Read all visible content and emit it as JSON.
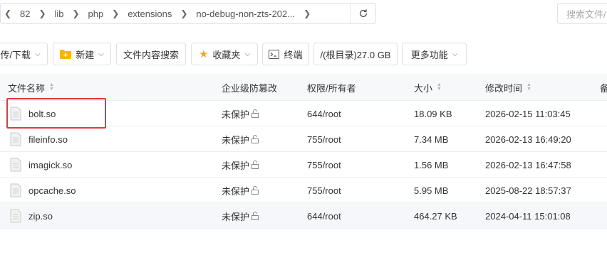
{
  "breadcrumb": {
    "segments": [
      "82",
      "lib",
      "php",
      "extensions",
      "no-debug-non-zts-202..."
    ]
  },
  "search": {
    "placeholder": "搜索文件/目录"
  },
  "toolbar": {
    "upload_label": "传/下载",
    "new_label": "新建",
    "content_search_label": "文件内容搜索",
    "favorites_label": "收藏夹",
    "terminal_label": "终端",
    "disk_label": "/(根目录)27.0 GB",
    "more_label": "更多功能"
  },
  "table": {
    "headers": {
      "name": "文件名称",
      "protection": "企业级防篡改",
      "perm": "权限/所有者",
      "size": "大小",
      "mtime": "修改时间",
      "extra": "备"
    },
    "rows": [
      {
        "name": "bolt.so",
        "protection": "未保护",
        "perm": "644/root",
        "size": "18.09 KB",
        "mtime": "2026-02-15 11:03:45"
      },
      {
        "name": "fileinfo.so",
        "protection": "未保护",
        "perm": "755/root",
        "size": "7.34 MB",
        "mtime": "2026-02-13 16:49:20"
      },
      {
        "name": "imagick.so",
        "protection": "未保护",
        "perm": "755/root",
        "size": "1.56 MB",
        "mtime": "2026-02-13 16:47:58"
      },
      {
        "name": "opcache.so",
        "protection": "未保护",
        "perm": "755/root",
        "size": "5.95 MB",
        "mtime": "2025-08-22 18:57:37"
      },
      {
        "name": "zip.so",
        "protection": "未保护",
        "perm": "644/root",
        "size": "464.27 KB",
        "mtime": "2024-04-11 15:01:08"
      }
    ]
  },
  "colors": {
    "highlight": "#e53935",
    "folder": "#f5b800",
    "star": "#f5a623"
  }
}
